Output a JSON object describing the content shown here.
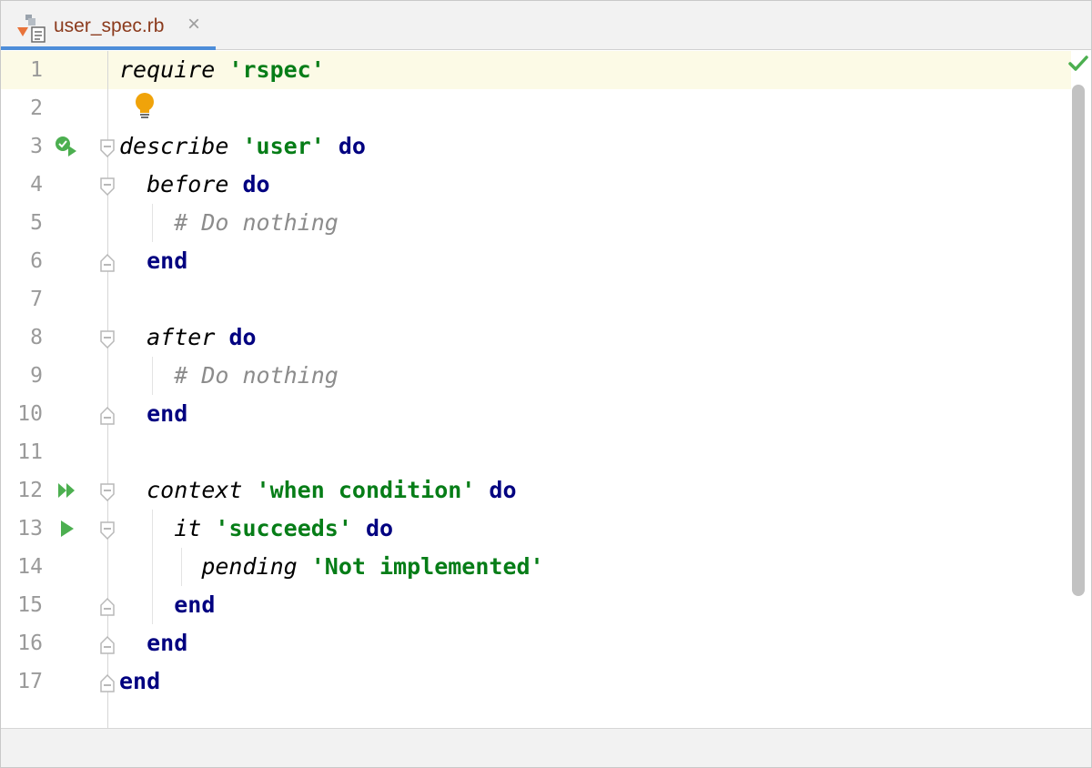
{
  "tab": {
    "title": "user_spec.rb",
    "close_glyph": "×"
  },
  "gutter": {
    "line_numbers": [
      "1",
      "2",
      "3",
      "4",
      "5",
      "6",
      "7",
      "8",
      "9",
      "10",
      "11",
      "12",
      "13",
      "14",
      "15",
      "16",
      "17"
    ]
  },
  "code": {
    "lines": [
      [
        {
          "t": "require",
          "c": "meth"
        },
        {
          "t": " "
        },
        {
          "t": "'rspec'",
          "c": "str"
        }
      ],
      [],
      [
        {
          "t": "describe",
          "c": "meth"
        },
        {
          "t": " "
        },
        {
          "t": "'user'",
          "c": "str"
        },
        {
          "t": " "
        },
        {
          "t": "do",
          "c": "kw"
        }
      ],
      [
        {
          "t": "  "
        },
        {
          "t": "before",
          "c": "meth"
        },
        {
          "t": " "
        },
        {
          "t": "do",
          "c": "kw"
        }
      ],
      [
        {
          "t": "    "
        },
        {
          "t": "# Do nothing",
          "c": "cmt"
        }
      ],
      [
        {
          "t": "  "
        },
        {
          "t": "end",
          "c": "kw"
        }
      ],
      [],
      [
        {
          "t": "  "
        },
        {
          "t": "after",
          "c": "meth"
        },
        {
          "t": " "
        },
        {
          "t": "do",
          "c": "kw"
        }
      ],
      [
        {
          "t": "    "
        },
        {
          "t": "# Do nothing",
          "c": "cmt"
        }
      ],
      [
        {
          "t": "  "
        },
        {
          "t": "end",
          "c": "kw"
        }
      ],
      [],
      [
        {
          "t": "  "
        },
        {
          "t": "context",
          "c": "meth"
        },
        {
          "t": " "
        },
        {
          "t": "'when condition'",
          "c": "str"
        },
        {
          "t": " "
        },
        {
          "t": "do",
          "c": "kw"
        }
      ],
      [
        {
          "t": "    "
        },
        {
          "t": "it",
          "c": "meth"
        },
        {
          "t": " "
        },
        {
          "t": "'succeeds'",
          "c": "str"
        },
        {
          "t": " "
        },
        {
          "t": "do",
          "c": "kw"
        }
      ],
      [
        {
          "t": "      "
        },
        {
          "t": "pending",
          "c": "meth"
        },
        {
          "t": " "
        },
        {
          "t": "'Not implemented'",
          "c": "str"
        }
      ],
      [
        {
          "t": "    "
        },
        {
          "t": "end",
          "c": "kw"
        }
      ],
      [
        {
          "t": "  "
        },
        {
          "t": "end",
          "c": "kw"
        }
      ],
      [
        {
          "t": "end",
          "c": "kw"
        }
      ]
    ]
  },
  "colors": {
    "keyword": "#000080",
    "string": "#067d17",
    "comment": "#8c8c8c",
    "run_icon": "#4caf50",
    "caret_line": "#fcfae6",
    "tab_accent": "#4d8dd9"
  },
  "icons": {
    "file": "ruby-test-file-icon",
    "close": "close-icon",
    "intention": "lightbulb-icon",
    "inspection_ok": "checkmark-icon",
    "run_passed": "run-test-passed-icon",
    "run_all": "run-all-tests-icon",
    "run": "run-test-icon"
  }
}
